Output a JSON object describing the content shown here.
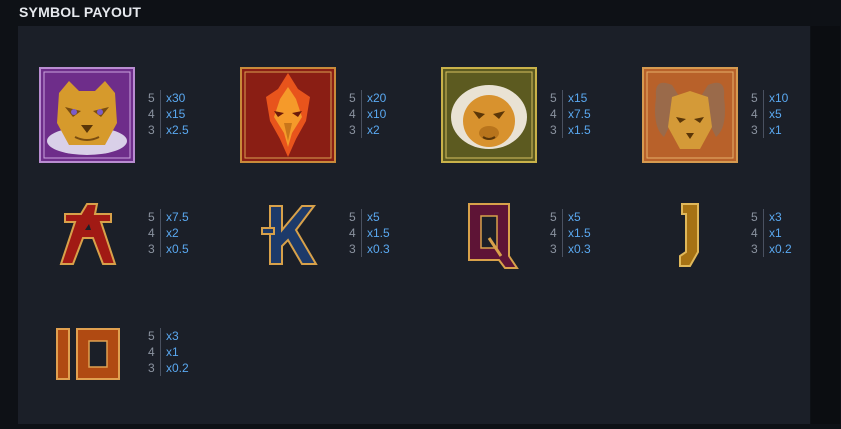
{
  "title": "SYMBOL PAYOUT",
  "symbols": [
    {
      "name": "tiger",
      "pays": [
        {
          "count": "5",
          "mult": "x30"
        },
        {
          "count": "4",
          "mult": "x15"
        },
        {
          "count": "3",
          "mult": "x2.5"
        }
      ]
    },
    {
      "name": "phoenix",
      "pays": [
        {
          "count": "5",
          "mult": "x20"
        },
        {
          "count": "4",
          "mult": "x10"
        },
        {
          "count": "3",
          "mult": "x2"
        }
      ]
    },
    {
      "name": "monkey",
      "pays": [
        {
          "count": "5",
          "mult": "x15"
        },
        {
          "count": "4",
          "mult": "x7.5"
        },
        {
          "count": "3",
          "mult": "x1.5"
        }
      ]
    },
    {
      "name": "rabbit",
      "pays": [
        {
          "count": "5",
          "mult": "x10"
        },
        {
          "count": "4",
          "mult": "x5"
        },
        {
          "count": "3",
          "mult": "x1"
        }
      ]
    },
    {
      "name": "A",
      "pays": [
        {
          "count": "5",
          "mult": "x7.5"
        },
        {
          "count": "4",
          "mult": "x2"
        },
        {
          "count": "3",
          "mult": "x0.5"
        }
      ]
    },
    {
      "name": "K",
      "pays": [
        {
          "count": "5",
          "mult": "x5"
        },
        {
          "count": "4",
          "mult": "x1.5"
        },
        {
          "count": "3",
          "mult": "x0.3"
        }
      ]
    },
    {
      "name": "Q",
      "pays": [
        {
          "count": "5",
          "mult": "x5"
        },
        {
          "count": "4",
          "mult": "x1.5"
        },
        {
          "count": "3",
          "mult": "x0.3"
        }
      ]
    },
    {
      "name": "J",
      "pays": [
        {
          "count": "5",
          "mult": "x3"
        },
        {
          "count": "4",
          "mult": "x1"
        },
        {
          "count": "3",
          "mult": "x0.2"
        }
      ]
    },
    {
      "name": "10",
      "pays": [
        {
          "count": "5",
          "mult": "x3"
        },
        {
          "count": "4",
          "mult": "x1"
        },
        {
          "count": "3",
          "mult": "x0.2"
        }
      ]
    }
  ],
  "colors": {
    "multiplier": "#5aa8f0",
    "count": "#8b93a0",
    "panel": "#1b1f28"
  }
}
